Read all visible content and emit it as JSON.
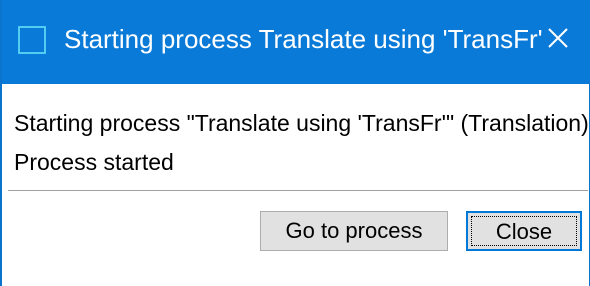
{
  "window": {
    "title": "Starting process Translate using 'TransFr'",
    "app_icon": "window-icon",
    "close_icon": "close-icon",
    "accent_color": "#0a7ad8"
  },
  "message": {
    "line1": "Starting process \"Translate using 'TransFr'\" (Translation).",
    "line2": "Process started"
  },
  "buttons": {
    "go_to_process": "Go to process",
    "close": "Close"
  }
}
